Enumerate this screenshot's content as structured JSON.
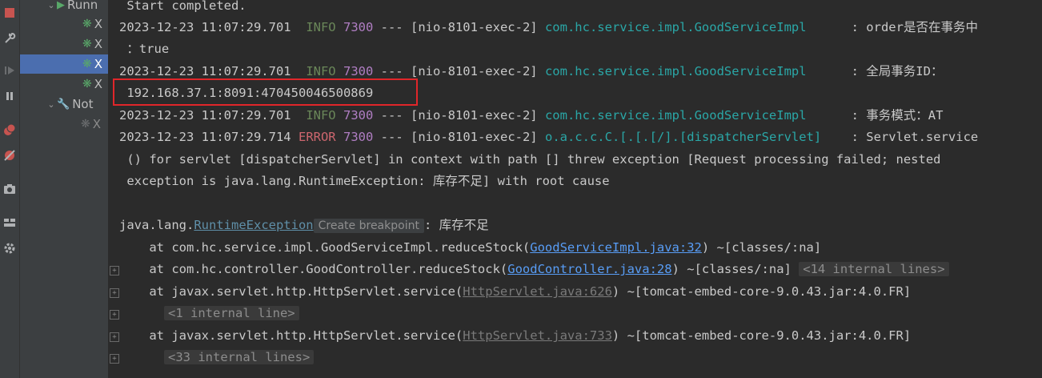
{
  "tree": {
    "items": [
      {
        "label": "Runn",
        "kind": "run-group"
      },
      {
        "label": "X",
        "kind": "service"
      },
      {
        "label": "X",
        "kind": "service"
      },
      {
        "label": "X",
        "kind": "service-selected"
      },
      {
        "label": "X",
        "kind": "service"
      },
      {
        "label": "Not",
        "kind": "not-started-group"
      },
      {
        "label": "X",
        "kind": "service-stopped"
      }
    ]
  },
  "console": {
    "lines": [
      {
        "text": " Start completed."
      },
      {
        "ts": "2023-12-23 11:07:29.701",
        "level": "INFO",
        "pid": "7300",
        "sep": " --- ",
        "thread": "[nio-8101-exec-2]",
        "logger": "com.hc.service.impl.GoodServiceImpl",
        "colon": ":",
        "msg": "order是否在事务中"
      },
      {
        "text": " ：true"
      },
      {
        "ts": "2023-12-23 11:07:29.701",
        "level": "INFO",
        "pid": "7300",
        "sep": " --- ",
        "thread": "[nio-8101-exec-2]",
        "logger": "com.hc.service.impl.GoodServiceImpl",
        "colon": ":",
        "msg": "全局事务ID："
      },
      {
        "text": " 192.168.37.1:8091:470450046500869"
      },
      {
        "ts": "2023-12-23 11:07:29.701",
        "level": "INFO",
        "pid": "7300",
        "sep": " --- ",
        "thread": "[nio-8101-exec-2]",
        "logger": "com.hc.service.impl.GoodServiceImpl",
        "colon": ":",
        "msg": "事务模式：AT"
      },
      {
        "ts": "2023-12-23 11:07:29.714",
        "level": "ERROR",
        "pid": "7300",
        "sep": " --- ",
        "thread": "[nio-8101-exec-2]",
        "logger": "o.a.c.c.C.[.[.[/].[dispatcherServlet]",
        "colon": ":",
        "msg": "Servlet.service"
      },
      {
        "text": " () for servlet [dispatcherServlet] in context with path [] threw exception [Request processing failed; nested"
      },
      {
        "text": " exception is java.lang.RuntimeException: 库存不足] with root cause"
      },
      {
        "text": ""
      },
      {
        "exc_prefix": "java.lang.",
        "exc_name": "RuntimeException",
        "breakpoint": "Create breakpoint",
        "exc_msg": ": 库存不足"
      },
      {
        "at": "    at com.hc.service.impl.GoodServiceImpl.reduceStock(",
        "src": "GoodServiceImpl.java:32",
        "tail": ") ~[classes/:na]"
      },
      {
        "at": "    at com.hc.controller.GoodController.reduceStock(",
        "src": "GoodController.java:28",
        "tail": ") ~[classes/:na]",
        "fold": "<14 internal lines>"
      },
      {
        "at": "    at javax.servlet.http.HttpServlet.service(",
        "src_dim": "HttpServlet.java:626",
        "tail": ") ~[tomcat-embed-core-9.0.43.jar:4.0.FR]"
      },
      {
        "fold_only": "<1 internal line>"
      },
      {
        "at": "    at javax.servlet.http.HttpServlet.service(",
        "src_dim": "HttpServlet.java:733",
        "tail": ") ~[tomcat-embed-core-9.0.43.jar:4.0.FR]"
      },
      {
        "fold_only": "<33 internal lines>"
      }
    ]
  },
  "colors": {
    "background": "#2b2b2b",
    "info": "#6a8759",
    "error": "#cc666e",
    "pid": "#b07ec3",
    "logger": "#2aa7a7",
    "link": "#589df6",
    "highlight_box": "#e0262a",
    "selection": "#4b6eaf"
  }
}
